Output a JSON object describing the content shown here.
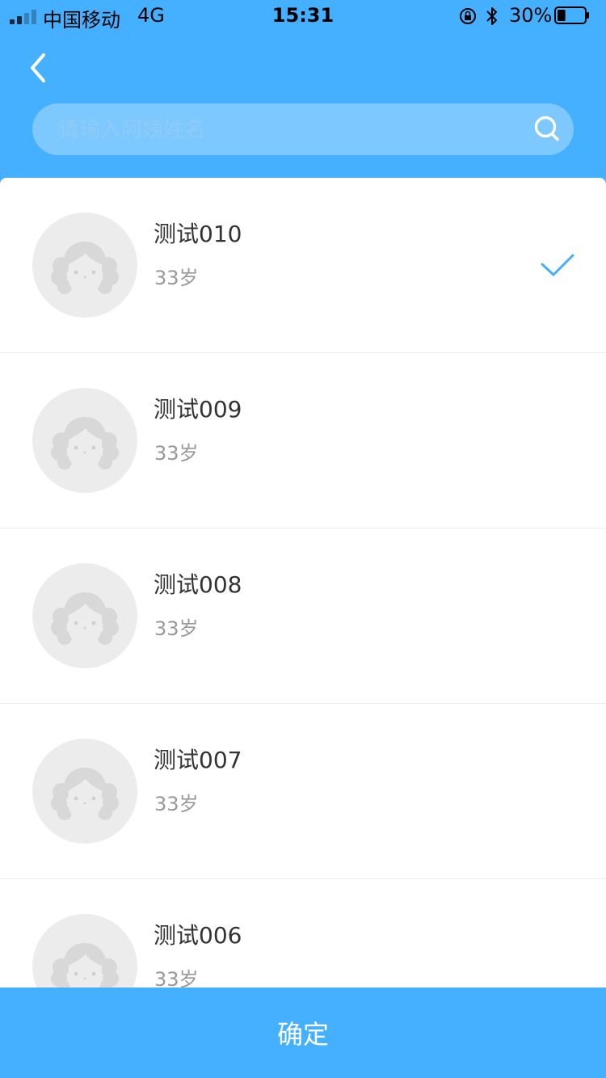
{
  "status_bar": {
    "carrier": "中国移动",
    "network": "4G",
    "time": "15:31",
    "battery_percent": "30%",
    "battery_level": 0.3,
    "signal_bars": 4,
    "signal_bars_filled": 2
  },
  "header": {
    "back_icon": "chevron-left-icon",
    "background_color": "#44b0ff"
  },
  "search": {
    "placeholder": "请输入阿姨姓名",
    "value": "",
    "icon": "search-icon"
  },
  "caregivers": [
    {
      "name": "测试010",
      "age": "33岁",
      "selected": true
    },
    {
      "name": "测试009",
      "age": "33岁",
      "selected": false
    },
    {
      "name": "测试008",
      "age": "33岁",
      "selected": false
    },
    {
      "name": "测试007",
      "age": "33岁",
      "selected": false
    },
    {
      "name": "测试006",
      "age": "33岁",
      "selected": false
    }
  ],
  "footer": {
    "confirm_label": "确定",
    "accent_color": "#44b0ff"
  }
}
